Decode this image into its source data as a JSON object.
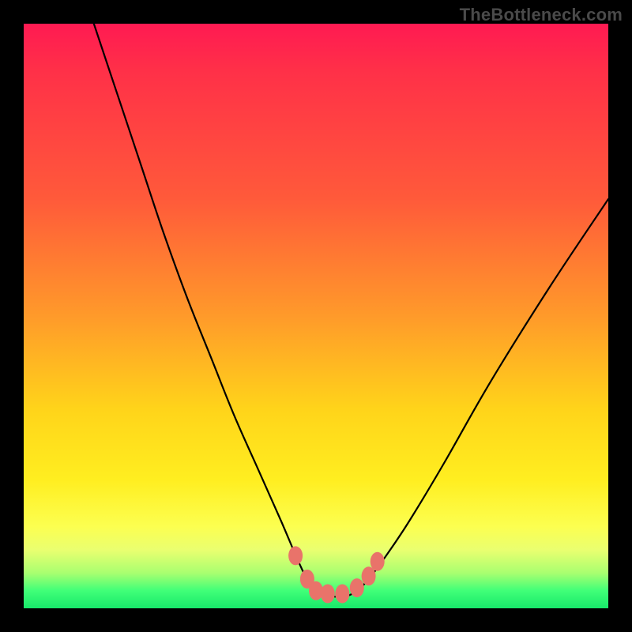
{
  "watermark": "TheBottleneck.com",
  "chart_data": {
    "type": "line",
    "title": "",
    "xlabel": "",
    "ylabel": "",
    "xlim": [
      0,
      100
    ],
    "ylim": [
      0,
      100
    ],
    "series": [
      {
        "name": "bottleneck-curve",
        "x": [
          12,
          16,
          20,
          24,
          28,
          32,
          36,
          40,
          44,
          47,
          49,
          51,
          53,
          55,
          57,
          59,
          62,
          66,
          72,
          80,
          90,
          100
        ],
        "values": [
          100,
          88,
          76,
          64,
          53,
          43,
          33,
          24,
          15,
          8,
          4,
          2,
          2,
          2,
          3,
          5,
          9,
          15,
          25,
          39,
          55,
          70
        ]
      }
    ],
    "markers": {
      "name": "highlight-points",
      "x": [
        46.5,
        48.5,
        50.0,
        52.0,
        54.5,
        57.0,
        59.0,
        60.5
      ],
      "values": [
        9.0,
        5.0,
        3.0,
        2.5,
        2.5,
        3.5,
        5.5,
        8.0
      ]
    },
    "gradient_stops": [
      {
        "pos": 0,
        "color": "#ff1a52"
      },
      {
        "pos": 30,
        "color": "#ff5a3a"
      },
      {
        "pos": 50,
        "color": "#ff9a2a"
      },
      {
        "pos": 70,
        "color": "#ffd41a"
      },
      {
        "pos": 86,
        "color": "#fcff50"
      },
      {
        "pos": 94,
        "color": "#a8ff70"
      },
      {
        "pos": 100,
        "color": "#18e86a"
      }
    ]
  }
}
